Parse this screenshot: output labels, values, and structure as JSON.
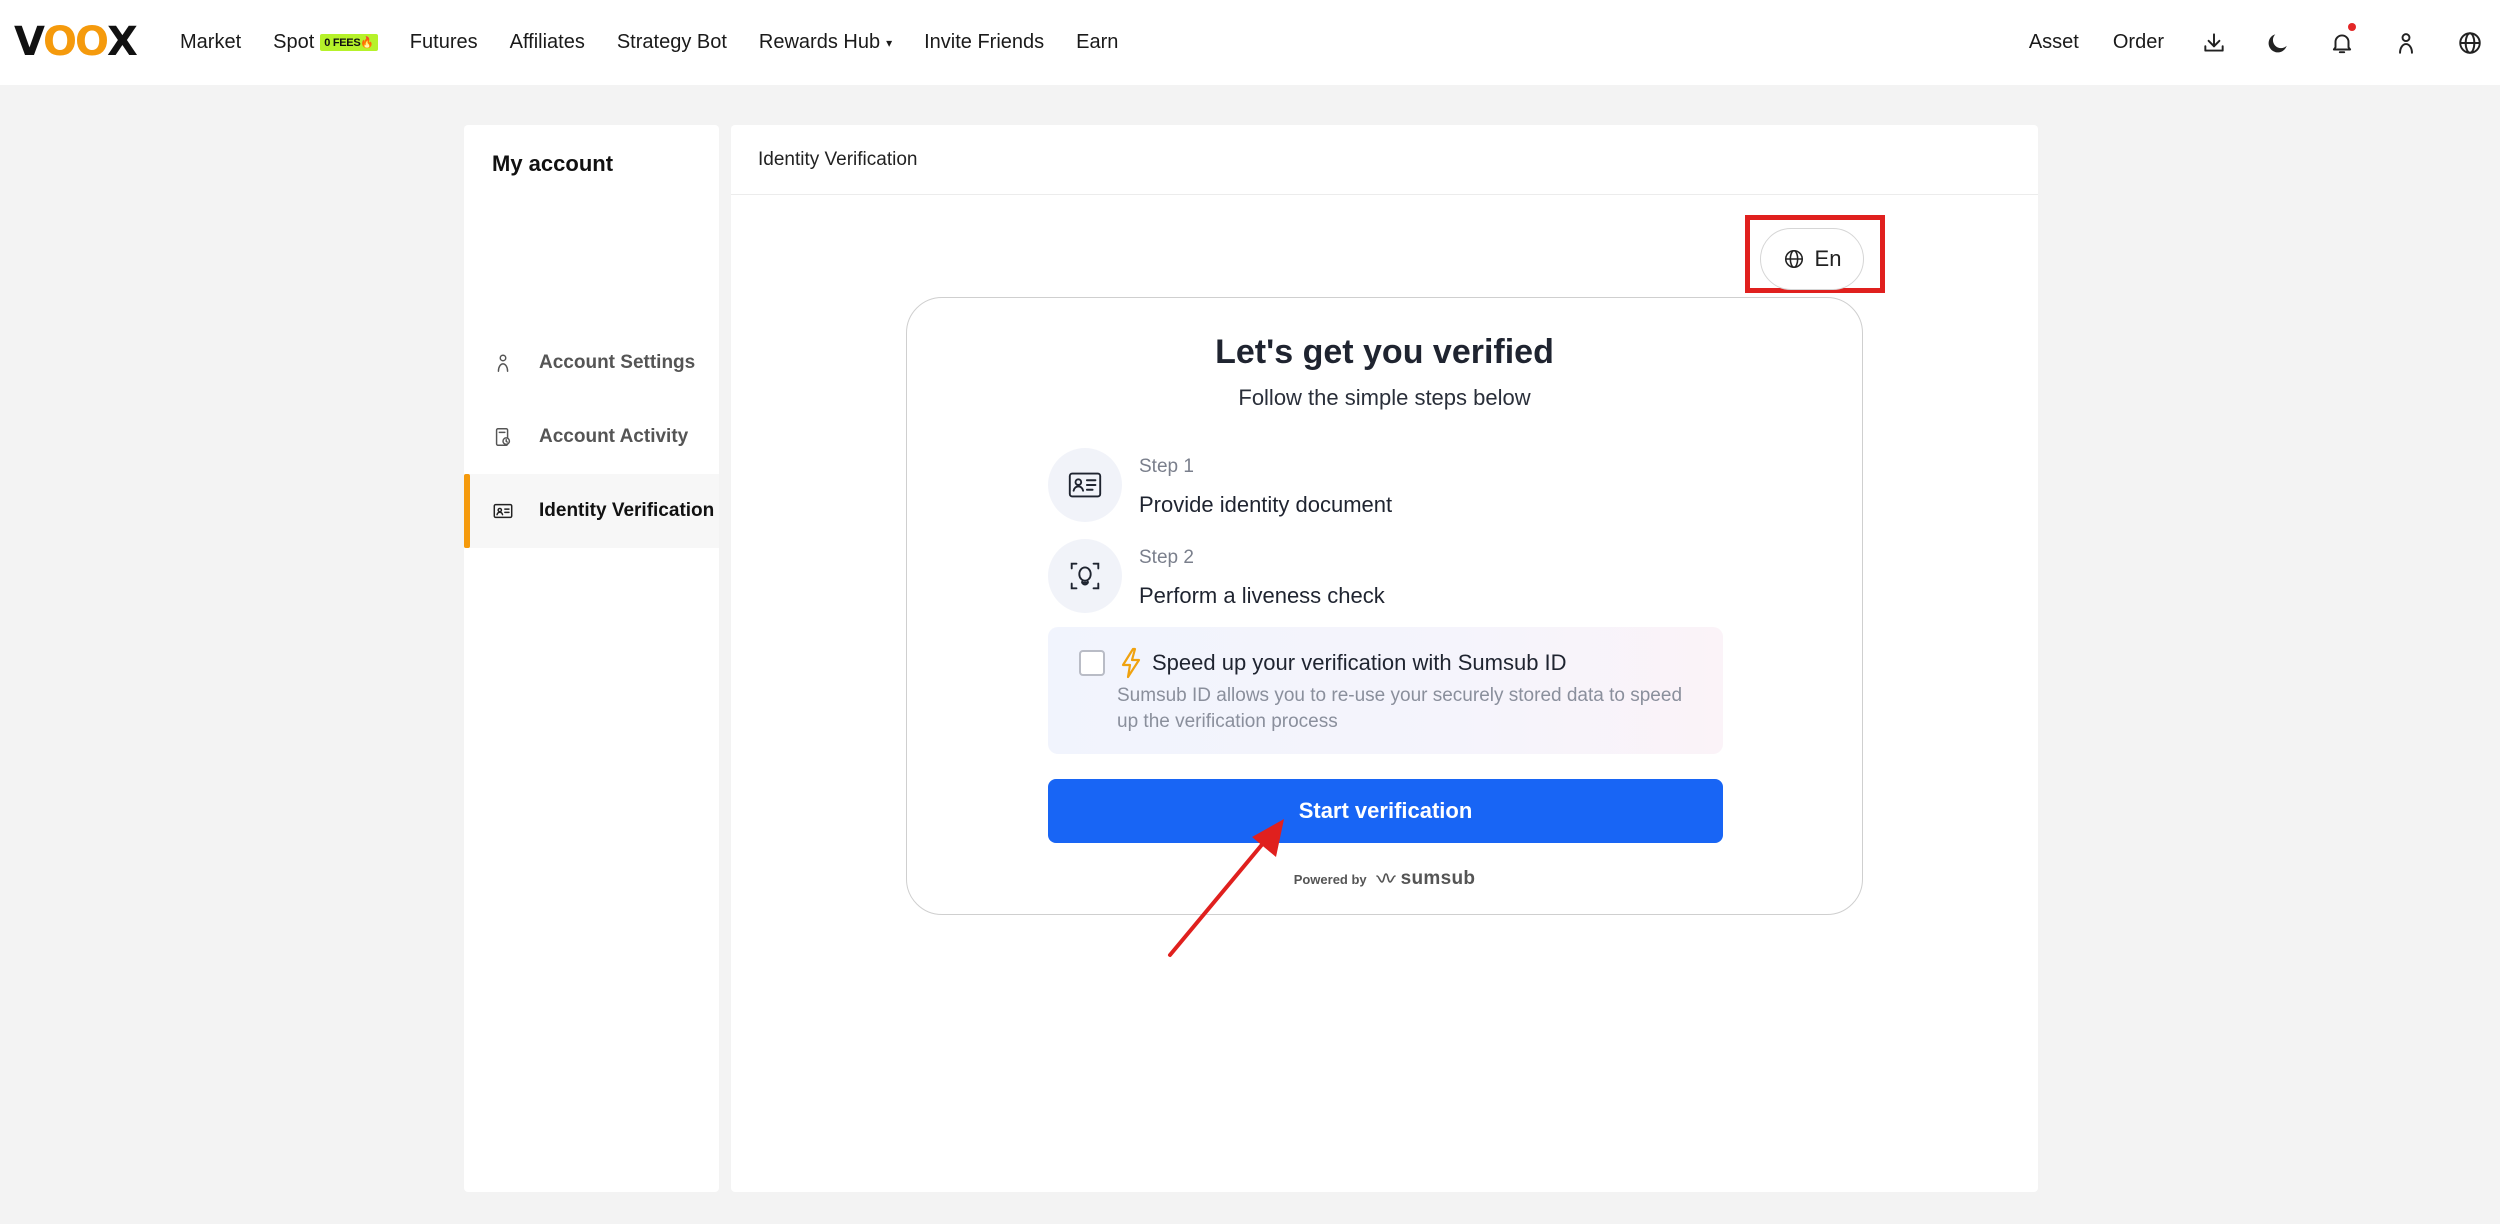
{
  "topbar": {
    "logo_text_a": "V",
    "logo_text_oo": "OO",
    "logo_text_b": "X",
    "nav": [
      {
        "label": "Market"
      },
      {
        "label": "Spot",
        "badge": "0 FEES🔥"
      },
      {
        "label": "Futures"
      },
      {
        "label": "Affiliates"
      },
      {
        "label": "Strategy Bot"
      },
      {
        "label": "Rewards Hub",
        "caret": "▾"
      },
      {
        "label": "Invite Friends"
      },
      {
        "label": "Earn"
      }
    ],
    "right": {
      "asset_label": "Asset",
      "order_label": "Order",
      "icons": [
        "download-icon",
        "moon-icon",
        "bell-icon",
        "user-icon",
        "globe-icon"
      ]
    }
  },
  "sidebar": {
    "title": "My account",
    "items": [
      {
        "label": "Account Settings",
        "icon": "user-icon",
        "active": false
      },
      {
        "label": "Account Activity",
        "icon": "activity-icon",
        "active": false
      },
      {
        "label": "Identity Verification",
        "icon": "id-card-icon",
        "active": true
      }
    ]
  },
  "main": {
    "header": "Identity Verification",
    "language": {
      "label": "En",
      "icon": "globe-icon"
    },
    "card": {
      "title": "Let's get you verified",
      "subtitle": "Follow the simple steps below",
      "steps": [
        {
          "num": "Step 1",
          "desc": "Provide identity document",
          "icon": "id-document-icon"
        },
        {
          "num": "Step 2",
          "desc": "Perform a liveness check",
          "icon": "face-scan-icon"
        }
      ],
      "speed_up": {
        "checked": false,
        "title": "Speed up your verification with Sumsub ID",
        "desc": "Sumsub ID allows you to re-use your securely stored data to speed up the verification process"
      },
      "start_button": "Start verification",
      "powered_by": "Powered by",
      "brand": "sumsub"
    }
  },
  "colors": {
    "accent_orange": "#f59a0c",
    "primary_blue": "#1865f5",
    "annotation_red": "#e0201e",
    "badge_green": "#b6f22a"
  }
}
